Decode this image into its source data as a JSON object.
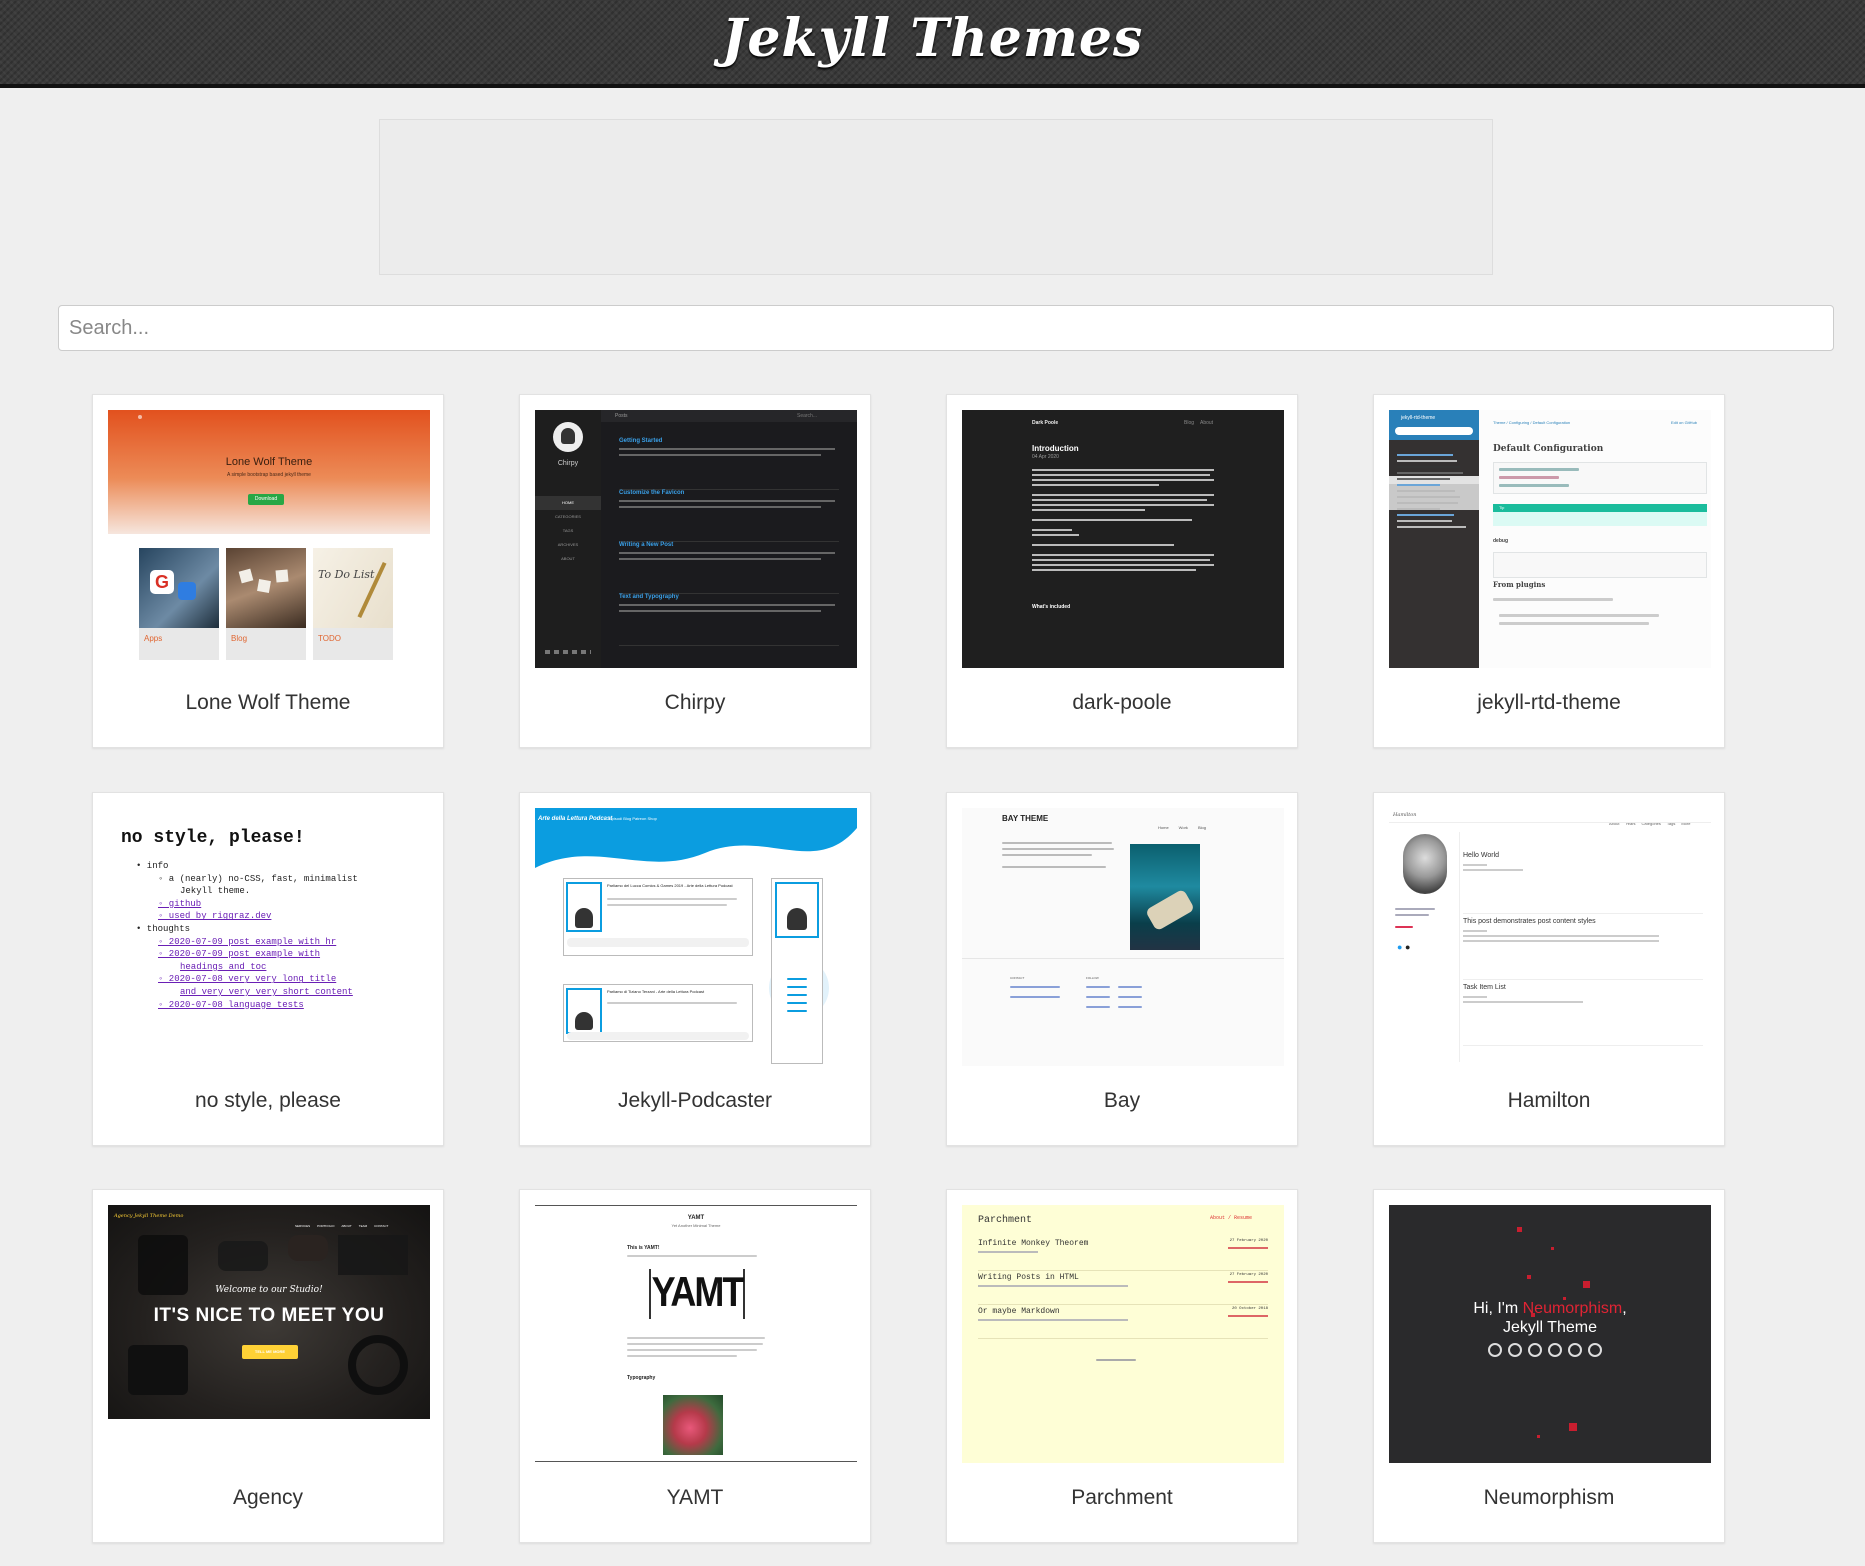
{
  "header": {
    "title": "Jekyll Themes"
  },
  "search": {
    "placeholder": "Search..."
  },
  "themes": [
    {
      "name": "Lone Wolf Theme",
      "preview": {
        "hero_title": "Lone Wolf Theme",
        "hero_subtitle": "A simple bootstrap based jekyll theme",
        "download_label": "Download",
        "tile_labels": [
          "Apps",
          "Blog",
          "TODO"
        ],
        "tile_glyph": "To Do List"
      }
    },
    {
      "name": "Chirpy",
      "preview": {
        "site_name": "Chirpy",
        "nav": [
          "HOME",
          "CATEGORIES",
          "TAGS",
          "ARCHIVES",
          "ABOUT"
        ],
        "topbar_label": "Posts",
        "search_label": "Search...",
        "posts": [
          "Getting Started",
          "Customize the Favicon",
          "Writing a New Post",
          "Text and Typography"
        ]
      }
    },
    {
      "name": "dark-poole",
      "preview": {
        "brand": "Dark Poole",
        "nav": [
          "Blog",
          "About"
        ],
        "post_title": "Introduction",
        "post_date": "04 Apr 2020",
        "section_heading": "What's included"
      }
    },
    {
      "name": "jekyll-rtd-theme",
      "preview": {
        "brand": "jekyll-rtd-theme",
        "heading": "Default Configuration",
        "tip_label": "Tip",
        "sub_heading": "debug",
        "sub_heading_2": "From plugins",
        "breadcrumb": "Theme / Configuring / Default Configuration",
        "edit_label": "Edit on GitHub"
      }
    },
    {
      "name": "no style, please",
      "preview": {
        "heading": "no style, please!",
        "lines": [
          {
            "text": "• info",
            "indent": 0,
            "link": false
          },
          {
            "text": "◦ a (nearly) no-CSS, fast, minimalist",
            "indent": 1,
            "link": false
          },
          {
            "text": "Jekyll theme.",
            "indent": 2,
            "link": false
          },
          {
            "text": "◦ github",
            "indent": 1,
            "link": true
          },
          {
            "text": "◦ used by riggraz.dev",
            "indent": 1,
            "link": true
          },
          {
            "text": "• thoughts",
            "indent": 0,
            "link": false
          },
          {
            "text": "◦ 2020-07-09 post example with hr",
            "indent": 1,
            "link": true
          },
          {
            "text": "◦ 2020-07-09 post example with",
            "indent": 1,
            "link": true
          },
          {
            "text": "headings and toc",
            "indent": 2,
            "link": true
          },
          {
            "text": "◦ 2020-07-08 very very long title",
            "indent": 1,
            "link": true
          },
          {
            "text": "and very very very short content",
            "indent": 2,
            "link": true
          },
          {
            "text": "◦ 2020-07-08 language tests",
            "indent": 1,
            "link": true
          }
        ]
      }
    },
    {
      "name": "Jekyll-Podcaster",
      "preview": {
        "brand": "Arte della Lettura Podcast",
        "nav": "Episodi  Blog  Patreon  Shop",
        "episodes": [
          "Parliamo del Lucca Comics & Games 2019 - Arte della Lettura Podcast",
          "Parliamo di Tiziano Terzani - Arte della Lettura Podcast"
        ]
      }
    },
    {
      "name": "Bay",
      "preview": {
        "brand": "BAY THEME",
        "nav": [
          "Home",
          "Work",
          "Blog"
        ],
        "footer_cols": [
          "CONTACT",
          "FOLLOW"
        ]
      }
    },
    {
      "name": "Hamilton",
      "preview": {
        "brand": "Hamilton",
        "nav": [
          "About",
          "Years",
          "Categories",
          "Tags",
          "More"
        ],
        "posts": [
          "Hello World",
          "This post demonstrates post content styles",
          "Task Item List"
        ]
      }
    },
    {
      "name": "Agency",
      "preview": {
        "brand": "Agency Jekyll Theme Demo",
        "nav": [
          "SERVICES",
          "PORTFOLIO",
          "ABOUT",
          "TEAM",
          "CONTACT"
        ],
        "welcome": "Welcome to our Studio!",
        "headline": "IT'S NICE TO MEET YOU",
        "cta": "TELL ME MORE"
      }
    },
    {
      "name": "YAMT",
      "preview": {
        "brand": "YAMT",
        "subtitle": "Yet Another Minimal Theme",
        "post_title": "This is YAMT!",
        "logo": "YAMT",
        "section": "Typography"
      }
    },
    {
      "name": "Parchment",
      "preview": {
        "brand": "Parchment",
        "nav": "About / Resume",
        "posts": [
          {
            "title": "Infinite Monkey Theorem",
            "date": "27 February 2020"
          },
          {
            "title": "Writing Posts in HTML",
            "date": "27 February 2020"
          },
          {
            "title": "Or maybe Markdown",
            "date": "20 October 2018"
          }
        ]
      }
    },
    {
      "name": "Neumorphism",
      "preview": {
        "greeting": "Hi, I'm",
        "highlight": "Neumorphism",
        "subtitle": "Jekyll Theme"
      }
    }
  ]
}
